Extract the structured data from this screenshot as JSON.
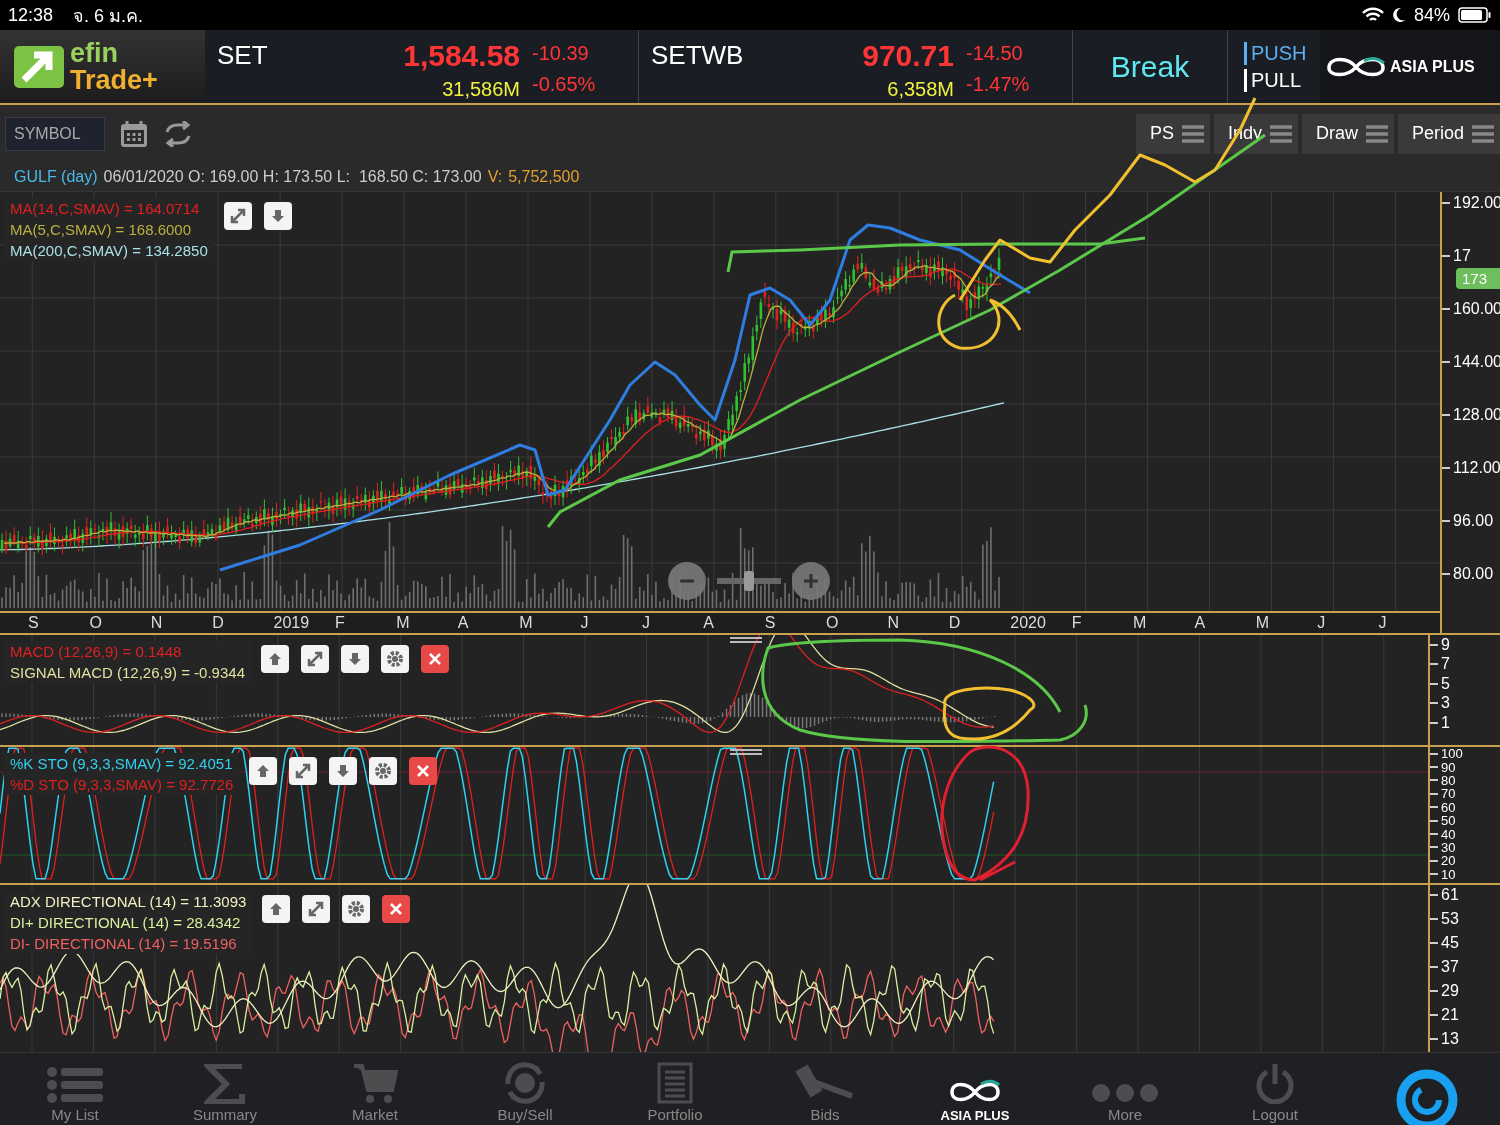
{
  "status_bar": {
    "time": "12:38",
    "date": "จ. 6 ม.ค.",
    "battery": "84%"
  },
  "header": {
    "logo": {
      "line_1": "efin",
      "line_2": "Trade+"
    },
    "indices": [
      {
        "name": "SET",
        "value": "1,584.58",
        "volume": "31,586M",
        "change": "-10.39",
        "percent": "-0.65%"
      },
      {
        "name": "SETWB",
        "value": "970.71",
        "volume": "6,358M",
        "change": "-14.50",
        "percent": "-1.47%"
      }
    ],
    "break": "Break",
    "push": "PUSH",
    "pull": "PULL",
    "broker": "ASIA PLUS"
  },
  "toolbar": {
    "symbol": {
      "placeholder": "SYMBOL"
    },
    "buttons": [
      "PS",
      "Indy",
      "Draw",
      "Period"
    ]
  },
  "quote": [
    {
      "text": "GULF (day)",
      "kind": "symbol"
    },
    {
      "text": "06/01/2020 O: 169.00 H: 173.50 L:  168.50 C: 173.00",
      "kind": "plain"
    },
    {
      "text": "V:",
      "kind": "volume"
    },
    {
      "text": "5,752,500",
      "kind": "volume"
    }
  ],
  "main_chart": {
    "legend": [
      {
        "text": "MA(14,C,SMAV) = 164.0714",
        "color": "#e02020"
      },
      {
        "text": "MA(5,C,SMAV) = 168.6000",
        "color": "#b8b040"
      },
      {
        "text": "MA(200,C,SMAV) = 134.2850",
        "color": "#a8e0e8"
      }
    ],
    "y_labels": [
      "192.00",
      "17",
      "160.00",
      "144.00",
      "128.00",
      "112.00",
      "96.00",
      "80.00"
    ],
    "price_tag": "173",
    "x_labels": [
      "S",
      "O",
      "N",
      "D",
      "2019",
      "F",
      "M",
      "A",
      "M",
      "J",
      "J",
      "A",
      "S",
      "O",
      "N",
      "D",
      "2020",
      "F",
      "M",
      "A",
      "M",
      "J",
      "J"
    ],
    "zoom_slider": {
      "level": 0.5
    }
  },
  "macd": {
    "legend": [
      {
        "text": "MACD (12,26,9) = 0.1448",
        "color": "#e02020"
      },
      {
        "text": "SIGNAL MACD (12,26,9) = -0.9344",
        "color": "#e0e0a0"
      }
    ],
    "y_labels": [
      "9",
      "7",
      "5",
      "3",
      "1"
    ]
  },
  "stochastic": {
    "legend": [
      {
        "text": "%K STO (9,3,3,SMAV) = 92.4051",
        "color": "#30d0f0"
      },
      {
        "text": "%D STO (9,3,3,SMAV) = 92.7726",
        "color": "#e02020"
      }
    ],
    "y_labels": [
      "100",
      "90",
      "80",
      "70",
      "60",
      "50",
      "40",
      "30",
      "20",
      "10"
    ]
  },
  "adx": {
    "legend": [
      {
        "text": "ADX DIRECTIONAL (14) = 11.3093",
        "color": "#f0f0c0"
      },
      {
        "text": "DI+ DIRECTIONAL (14) = 28.4342",
        "color": "#d8f0a0"
      },
      {
        "text": "DI- DIRECTIONAL (14) = 19.5196",
        "color": "#f06060"
      }
    ],
    "y_labels": [
      "61",
      "53",
      "45",
      "37",
      "29",
      "21",
      "13"
    ]
  },
  "nav": [
    {
      "label": "My List",
      "selected": false
    },
    {
      "label": "Summary",
      "selected": false
    },
    {
      "label": "Market",
      "selected": false
    },
    {
      "label": "Buy/Sell",
      "selected": false
    },
    {
      "label": "Portfolio",
      "selected": false
    },
    {
      "label": "Bids",
      "selected": false
    },
    {
      "label": "ASIA PLUS",
      "selected": true
    },
    {
      "label": "More",
      "selected": false
    },
    {
      "label": "Logout",
      "selected": false
    }
  ]
}
